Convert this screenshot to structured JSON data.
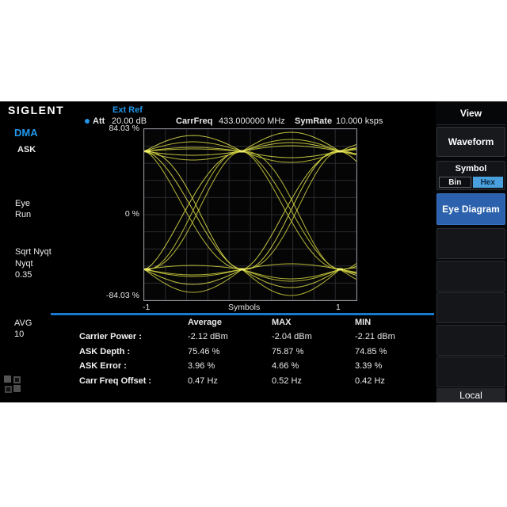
{
  "header": {
    "logo": "SIGLENT",
    "ext_ref": "Ext Ref",
    "att_label": "Att",
    "att_value": "20.00 dB",
    "carrfreq_label": "CarrFreq",
    "carrfreq_value": "433.000000 MHz",
    "symrate_label": "SymRate",
    "symrate_value": "10.000 ksps"
  },
  "sidebar": {
    "mode": "DMA",
    "modulation": "ASK",
    "trace_type": "Eye",
    "run_state": "Run",
    "filter_line1": "Sqrt Nyqt",
    "filter_line2": "Nyqt",
    "filter_value": "0.35",
    "avg_label": "AVG",
    "avg_value": "10"
  },
  "chart_data": {
    "type": "line",
    "subtype": "eye-diagram",
    "xlabel": "Symbols",
    "x_tick_left": "-1",
    "x_tick_right": "1",
    "y_tick_top": "84.03 %",
    "y_tick_mid": "0 %",
    "y_tick_bottom": "-84.03 %",
    "x_range_symbols": [
      -1,
      1.17
    ],
    "y_range_percent": [
      -84.03,
      84.03
    ],
    "high_level_percent": 62,
    "low_level_percent": -62,
    "grid_divisions": [
      10,
      10
    ],
    "trace_color": "#c9c93e",
    "traces": [
      {
        "sym": [
          1,
          1,
          1,
          1
        ],
        "bows": [
          -20,
          -24,
          -17
        ]
      },
      {
        "sym": [
          1,
          1,
          1,
          1
        ],
        "bows": [
          -12,
          -15,
          -9
        ]
      },
      {
        "sym": [
          1,
          1,
          1,
          1
        ],
        "bows": [
          -5,
          -7,
          -4
        ]
      },
      {
        "sym": [
          1,
          1,
          1,
          1
        ],
        "bows": [
          5,
          8,
          6
        ]
      },
      {
        "sym": [
          1,
          1,
          1,
          1
        ],
        "bows": [
          11,
          14,
          9
        ]
      },
      {
        "sym": [
          -1,
          -1,
          -1,
          -1
        ],
        "bows": [
          29,
          33,
          25
        ]
      },
      {
        "sym": [
          -1,
          -1,
          -1,
          -1
        ],
        "bows": [
          19,
          23,
          15
        ]
      },
      {
        "sym": [
          -1,
          -1,
          -1,
          -1
        ],
        "bows": [
          9,
          12,
          7
        ]
      },
      {
        "sym": [
          -1,
          -1,
          -1,
          -1
        ],
        "bows": [
          -5,
          -7,
          -4
        ]
      },
      {
        "sym": [
          1,
          -1,
          1,
          -1
        ],
        "gammas": [
          1,
          1,
          1
        ],
        "rip": 5
      },
      {
        "sym": [
          -1,
          1,
          -1,
          1
        ],
        "gammas": [
          1,
          1,
          1
        ],
        "rip": 5
      },
      {
        "sym": [
          1,
          -1,
          -1,
          1
        ],
        "gammas": [
          0.8,
          1,
          1.25
        ],
        "bows": [
          0,
          15,
          0
        ]
      },
      {
        "sym": [
          -1,
          1,
          1,
          -1
        ],
        "gammas": [
          0.8,
          1,
          1.25
        ],
        "bows": [
          0,
          -11,
          0
        ]
      },
      {
        "sym": [
          1,
          1,
          -1,
          -1
        ],
        "gammas": [
          1,
          1.2,
          1
        ],
        "bows": [
          -3,
          0,
          11
        ]
      },
      {
        "sym": [
          -1,
          -1,
          1,
          1
        ],
        "gammas": [
          1,
          1.2,
          1
        ],
        "bows": [
          7,
          0,
          -6
        ]
      },
      {
        "sym": [
          1,
          -1,
          1,
          1
        ],
        "gammas": [
          1.18,
          0.85,
          1
        ],
        "bows": [
          0,
          0,
          -8
        ]
      },
      {
        "sym": [
          -1,
          1,
          -1,
          -1
        ],
        "gammas": [
          1.18,
          0.85,
          1
        ],
        "bows": [
          0,
          0,
          9
        ]
      }
    ]
  },
  "table": {
    "headers": [
      "Average",
      "MAX",
      "MIN"
    ],
    "rows": [
      {
        "label": "Carrier Power :",
        "values": [
          "-2.12 dBm",
          "-2.04 dBm",
          "-2.21 dBm"
        ]
      },
      {
        "label": "ASK Depth :",
        "values": [
          "75.46 %",
          "75.87 %",
          "74.85 %"
        ]
      },
      {
        "label": "ASK Error :",
        "values": [
          "3.96 %",
          "4.66 %",
          "3.39 %"
        ]
      },
      {
        "label": "Carr Freq Offset :",
        "values": [
          "0.47 Hz",
          "0.52 Hz",
          "0.42 Hz"
        ]
      }
    ]
  },
  "menu": {
    "view": "View",
    "waveform": "Waveform",
    "symbol": "Symbol",
    "bin": "Bin",
    "hex": "Hex",
    "eye_diagram": "Eye Diagram",
    "local": "Local",
    "empty_count": 5
  },
  "colors": {
    "accent_blue": "#2196e8",
    "separator_blue": "#1779d0",
    "active_button_blue": "#2b61ad",
    "hex_highlight": "#4aa0dc",
    "trace_yellow": "#c9c93e"
  }
}
